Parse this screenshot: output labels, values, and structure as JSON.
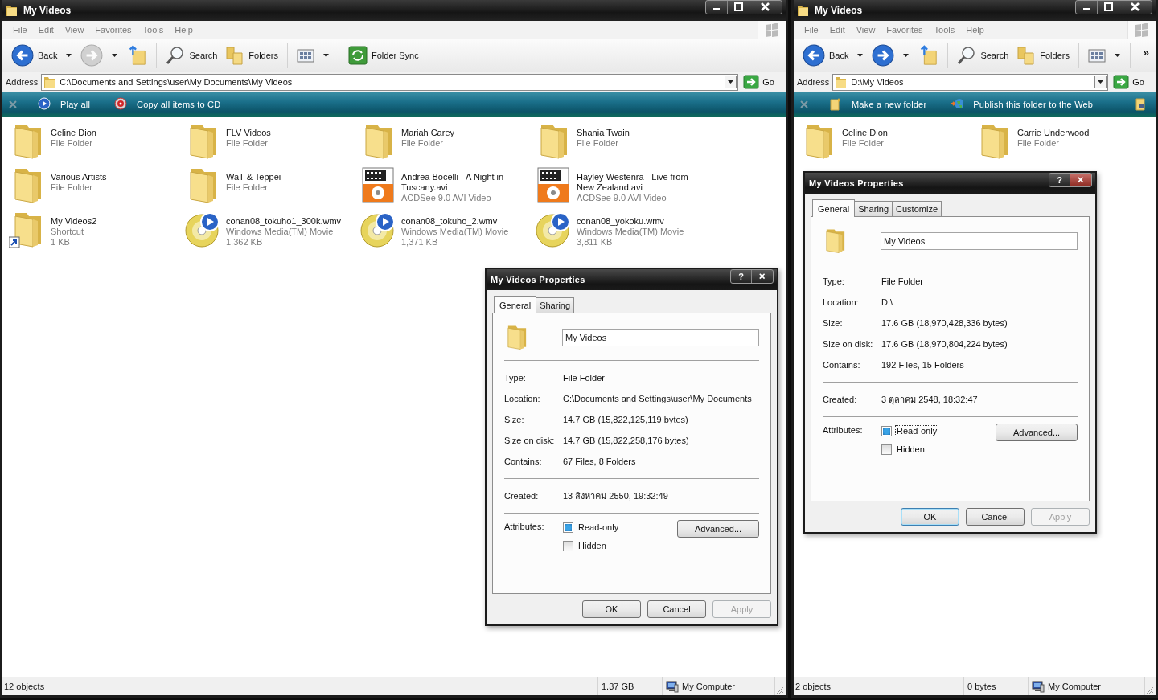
{
  "windows": [
    {
      "title": "My Videos",
      "menu": [
        "File",
        "Edit",
        "View",
        "Favorites",
        "Tools",
        "Help"
      ],
      "toolbar": [
        {
          "kind": "back",
          "label": "Back",
          "disabled": false
        },
        {
          "kind": "forward",
          "disabled": true
        },
        {
          "kind": "up"
        },
        {
          "kind": "search",
          "label": "Search"
        },
        {
          "kind": "folders",
          "label": "Folders"
        },
        {
          "kind": "views"
        },
        {
          "kind": "sync",
          "label": "Folder Sync"
        }
      ],
      "address_label": "Address",
      "address": "C:\\Documents and Settings\\user\\My Documents\\My Videos",
      "go": "Go",
      "tasks": [
        {
          "kind": "play",
          "label": "Play all"
        },
        {
          "kind": "cd",
          "label": "Copy all items to CD"
        }
      ],
      "items": [
        {
          "kind": "folder",
          "name": "Celine Dion",
          "details": [
            "File Folder"
          ]
        },
        {
          "kind": "folder",
          "name": "FLV Videos",
          "details": [
            "File Folder"
          ]
        },
        {
          "kind": "folder",
          "name": "Mariah Carey",
          "details": [
            "File Folder"
          ]
        },
        {
          "kind": "folder",
          "name": "Shania Twain",
          "details": [
            "File Folder"
          ]
        },
        {
          "kind": "folder",
          "name": "Various Artists",
          "details": [
            "File Folder"
          ]
        },
        {
          "kind": "folder",
          "name": "WaT & Teppei",
          "details": [
            "File Folder"
          ]
        },
        {
          "kind": "avi",
          "name": "Andrea Bocelli - A Night in Tuscany.avi",
          "details": [
            "ACDSee 9.0 AVI Video"
          ]
        },
        {
          "kind": "avi",
          "name": "Hayley Westenra - Live from New Zealand.avi",
          "details": [
            "ACDSee 9.0 AVI Video"
          ]
        },
        {
          "kind": "shortcut",
          "name": "My Videos2",
          "details": [
            "Shortcut",
            "1 KB"
          ]
        },
        {
          "kind": "wmv",
          "name": "conan08_tokuho1_300k.wmv",
          "details": [
            "Windows Media(TM) Movie",
            "1,362 KB"
          ]
        },
        {
          "kind": "wmv",
          "name": "conan08_tokuho_2.wmv",
          "details": [
            "Windows Media(TM) Movie",
            "1,371 KB"
          ]
        },
        {
          "kind": "wmv",
          "name": "conan08_yokoku.wmv",
          "details": [
            "Windows Media(TM) Movie",
            "3,811 KB"
          ]
        }
      ],
      "status": [
        {
          "kind": "count",
          "text": "12 objects"
        },
        {
          "kind": "size",
          "text": "1.37 GB"
        },
        {
          "kind": "zone",
          "text": "My Computer"
        }
      ],
      "dialog": {
        "title": "My Videos Properties",
        "help": "?",
        "tabs": [
          {
            "label": "General",
            "selected": true
          },
          {
            "label": "Sharing",
            "selected": false
          }
        ],
        "name": "My Videos",
        "sections": [
          [
            {
              "label": "Type:",
              "value": "File Folder"
            },
            {
              "label": "Location:",
              "value": "C:\\Documents and Settings\\user\\My Documents"
            },
            {
              "label": "Size:",
              "value": "14.7 GB (15,822,125,119 bytes)"
            },
            {
              "label": "Size on disk:",
              "value": "14.7 GB (15,822,258,176 bytes)"
            },
            {
              "label": "Contains:",
              "value": "67 Files, 8 Folders"
            }
          ],
          [
            {
              "label": "Created:",
              "value": "13 สิงหาคม 2550, 19:32:49"
            }
          ]
        ],
        "attributes_label": "Attributes:",
        "attributes": [
          {
            "label": "Read-only",
            "checked": true,
            "focused": false
          },
          {
            "label": "Hidden",
            "checked": false,
            "focused": false
          }
        ],
        "advanced": "Advanced...",
        "buttons": [
          {
            "label": "OK",
            "default": false,
            "disabled": false
          },
          {
            "label": "Cancel",
            "default": false,
            "disabled": false
          },
          {
            "label": "Apply",
            "default": false,
            "disabled": true
          }
        ]
      }
    },
    {
      "title": "My Videos",
      "menu": [
        "File",
        "Edit",
        "View",
        "Favorites",
        "Tools",
        "Help"
      ],
      "toolbar": [
        {
          "kind": "back",
          "label": "Back",
          "disabled": false
        },
        {
          "kind": "forward",
          "disabled": false
        },
        {
          "kind": "up"
        },
        {
          "kind": "search",
          "label": "Search"
        },
        {
          "kind": "folders",
          "label": "Folders"
        },
        {
          "kind": "views"
        },
        {
          "kind": "chevron",
          "label": "»"
        }
      ],
      "address_label": "Address",
      "address": "D:\\My Videos",
      "go": "Go",
      "tasks": [
        {
          "kind": "newfolder",
          "label": "Make a new folder"
        },
        {
          "kind": "publish",
          "label": "Publish this folder to the Web"
        },
        {
          "kind": "share"
        }
      ],
      "items": [
        {
          "kind": "folder",
          "name": "Celine Dion",
          "details": [
            "File Folder"
          ]
        },
        {
          "kind": "folder",
          "name": "Carrie Underwood",
          "details": [
            "File Folder"
          ]
        }
      ],
      "status": [
        {
          "kind": "count",
          "text": "2 objects"
        },
        {
          "kind": "size",
          "text": "0 bytes"
        },
        {
          "kind": "zone",
          "text": "My Computer"
        }
      ],
      "dialog": {
        "title": "My Videos Properties",
        "help": "?",
        "tabs": [
          {
            "label": "General",
            "selected": true
          },
          {
            "label": "Sharing",
            "selected": false
          },
          {
            "label": "Customize",
            "selected": false
          }
        ],
        "name": "My Videos",
        "sections": [
          [
            {
              "label": "Type:",
              "value": "File Folder"
            },
            {
              "label": "Location:",
              "value": "D:\\"
            },
            {
              "label": "Size:",
              "value": "17.6 GB (18,970,428,336 bytes)"
            },
            {
              "label": "Size on disk:",
              "value": "17.6 GB (18,970,804,224 bytes)"
            },
            {
              "label": "Contains:",
              "value": "192 Files, 15 Folders"
            }
          ],
          [
            {
              "label": "Created:",
              "value": "3 ตุลาคม 2548, 18:32:47"
            }
          ]
        ],
        "attributes_label": "Attributes:",
        "attributes": [
          {
            "label": "Read-only",
            "checked": true,
            "focused": true
          },
          {
            "label": "Hidden",
            "checked": false,
            "focused": false
          }
        ],
        "advanced": "Advanced...",
        "buttons": [
          {
            "label": "OK",
            "default": true,
            "disabled": false
          },
          {
            "label": "Cancel",
            "default": false,
            "disabled": false
          },
          {
            "label": "Apply",
            "default": false,
            "disabled": true
          }
        ]
      }
    }
  ]
}
